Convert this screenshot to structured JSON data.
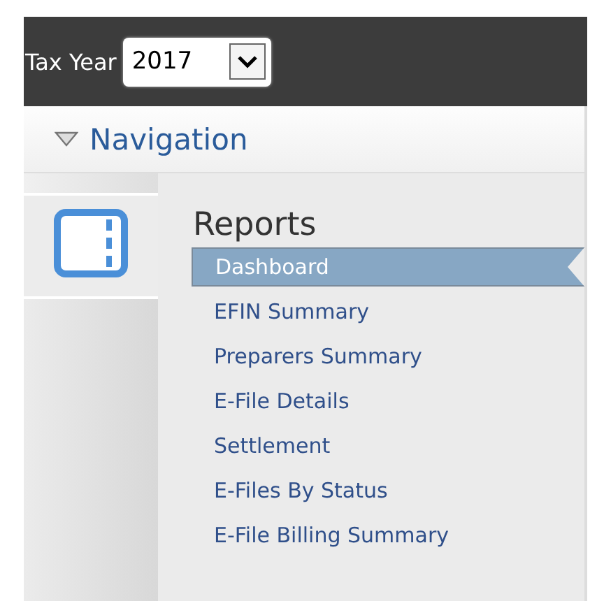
{
  "toolbar": {
    "label": "Tax Year",
    "year_select": {
      "value": "2017"
    }
  },
  "navigation": {
    "title": "Navigation",
    "expanded": true
  },
  "reports": {
    "title": "Reports",
    "items": [
      {
        "label": "Dashboard",
        "selected": true
      },
      {
        "label": "EFIN Summary",
        "selected": false
      },
      {
        "label": "Preparers Summary",
        "selected": false
      },
      {
        "label": "E-File Details",
        "selected": false
      },
      {
        "label": "Settlement",
        "selected": false
      },
      {
        "label": "E-Files By Status",
        "selected": false
      },
      {
        "label": "E-File Billing Summary",
        "selected": false
      }
    ]
  }
}
